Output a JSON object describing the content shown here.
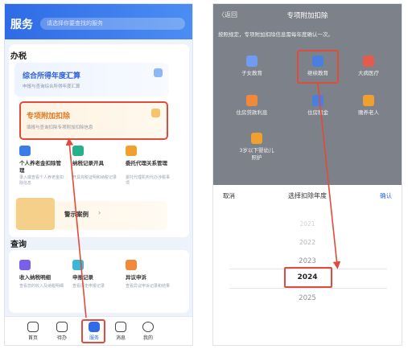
{
  "colors": {
    "brand_blue": "#2f6be6",
    "highlight_red": "#e14b3c",
    "orange": "#e0781e"
  },
  "left": {
    "header": {
      "title": "服务",
      "search_placeholder": "请选择你要查找的服务"
    },
    "sections": {
      "banshui": "办税",
      "chaxun": "查询"
    },
    "banner1": {
      "title": "综合所得年度汇算",
      "subtitle": "申报与查询综合所得年度汇算"
    },
    "banner2": {
      "title": "专项附加扣除",
      "subtitle": "填报与查询扣除专项附加扣除信息"
    },
    "services": [
      {
        "name": "个人养老金扣除管理",
        "desc": "录入或查看个人养老金扣除信息",
        "icon": "calculator-icon",
        "color": "#3b7de8"
      },
      {
        "name": "纳税记录开具",
        "desc": "开具完税证明和纳税记录",
        "icon": "document-icon",
        "color": "#27b08b"
      },
      {
        "name": "委托代理关系管理",
        "desc": "委托代理机构代办涉税事项",
        "icon": "handshake-icon",
        "color": "#f0a02f"
      }
    ],
    "warning": {
      "label": "警示案例",
      "arrow": "›"
    },
    "query": [
      {
        "name": "收入纳税明细",
        "desc": "查看您的收入及纳税明细",
        "icon": "receipt-icon",
        "color": "#7a5fe8"
      },
      {
        "name": "申报记录",
        "desc": "查看历史申报记录",
        "icon": "record-icon",
        "color": "#3cb6d6"
      },
      {
        "name": "异议申诉",
        "desc": "查看异议申诉记录和结果",
        "icon": "appeal-icon",
        "color": "#f08a3a"
      }
    ],
    "tabbar": [
      {
        "label": "首页",
        "icon": "home-icon"
      },
      {
        "label": "待办",
        "icon": "todo-icon"
      },
      {
        "label": "服务",
        "icon": "service-icon",
        "active": true
      },
      {
        "label": "消息",
        "icon": "message-icon"
      },
      {
        "label": "我的",
        "icon": "user-icon"
      }
    ]
  },
  "right": {
    "back": "〈返回",
    "title": "专项附加扣除",
    "notice": "按照规定，专项附加扣除信息需每年度确认一次。",
    "items": [
      {
        "label": "子女教育",
        "icon": "children-icon",
        "color": "#6e9cf0"
      },
      {
        "label": "继续教育",
        "icon": "graduation-cap-icon",
        "color": "#4a7fe0"
      },
      {
        "label": "大病医疗",
        "icon": "medical-icon",
        "color": "#e45b4e"
      },
      {
        "label": "住房贷款利息",
        "icon": "house-icon",
        "color": "#f08a3a"
      },
      {
        "label": "住房租金",
        "icon": "rent-icon",
        "color": "#4a7fe0"
      },
      {
        "label": "赡养老人",
        "icon": "elder-icon",
        "color": "#f0a02f"
      },
      {
        "label": "3岁以下婴幼儿照护",
        "icon": "baby-icon",
        "color": "#f0a02f"
      }
    ],
    "sheet": {
      "cancel": "取消",
      "title": "选择扣除年度",
      "confirm": "确认",
      "years": [
        "2021",
        "2022",
        "2023",
        "2024",
        "2025"
      ],
      "selected": "2024"
    }
  }
}
